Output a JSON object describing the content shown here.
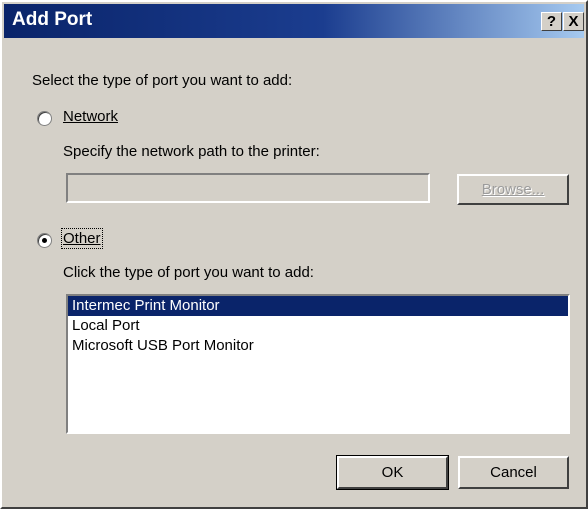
{
  "window": {
    "title": "Add Port",
    "help_glyph": "?",
    "close_glyph": "X"
  },
  "dialog": {
    "instruction": "Select the type of port you want to add:",
    "network": {
      "label": "Network",
      "selected": false,
      "path_prompt": "Specify the network path to the printer:",
      "path_value": "",
      "browse_label": "Browse..."
    },
    "other": {
      "label": "Other",
      "selected": true,
      "list_prompt": "Click the type of port you want to add:",
      "ports": [
        {
          "label": "Intermec Print Monitor",
          "selected": true
        },
        {
          "label": "Local Port",
          "selected": false
        },
        {
          "label": "Microsoft USB Port Monitor",
          "selected": false
        }
      ]
    },
    "ok_label": "OK",
    "cancel_label": "Cancel"
  },
  "colors": {
    "face": "#d4d0c8",
    "title_start": "#0a246a",
    "title_end": "#a6caf0",
    "selection": "#0a246a"
  }
}
